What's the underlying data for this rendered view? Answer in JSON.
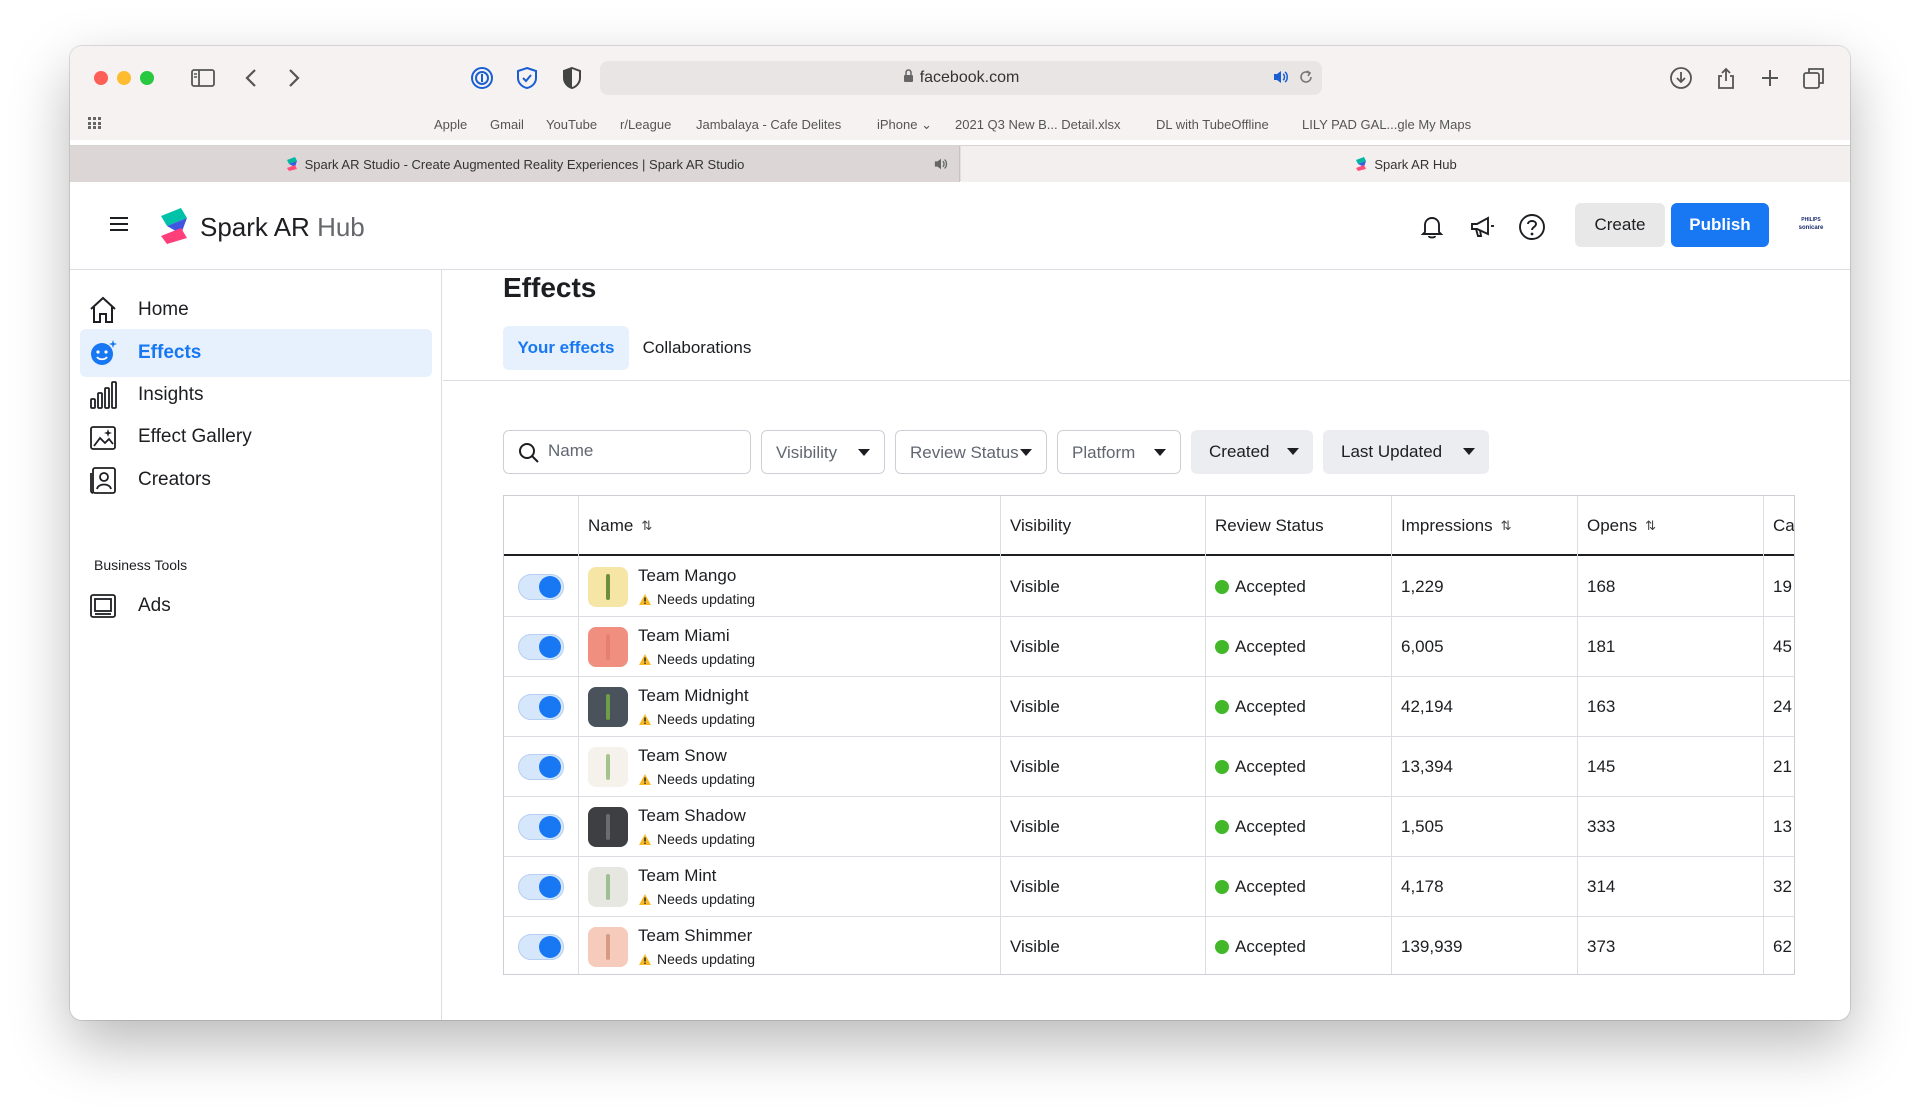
{
  "browser": {
    "url": "facebook.com",
    "bookmarks": [
      "Apple",
      "Gmail",
      "YouTube",
      "r/League",
      "Jambalaya - Cafe Delites",
      "iPhone",
      "2021 Q3 New B... Detail.xlsx",
      "DL with TubeOffline",
      "LILY PAD GAL...gle My Maps"
    ],
    "tabs": [
      {
        "label": "Spark AR Studio - Create Augmented Reality Experiences | Spark AR Studio",
        "active": false
      },
      {
        "label": "Spark AR Hub",
        "active": true
      }
    ]
  },
  "header": {
    "brand_main": "Spark AR",
    "brand_sub": "Hub",
    "create_label": "Create",
    "publish_label": "Publish",
    "badge_line1": "PHILIPS",
    "badge_line2": "sonicare",
    "accent": "#1877f2"
  },
  "sidebar": {
    "items": [
      {
        "label": "Home",
        "icon": "home-icon"
      },
      {
        "label": "Effects",
        "icon": "effects-icon",
        "active": true
      },
      {
        "label": "Insights",
        "icon": "insights-icon"
      },
      {
        "label": "Effect Gallery",
        "icon": "gallery-icon"
      },
      {
        "label": "Creators",
        "icon": "creators-icon"
      }
    ],
    "section_label": "Business Tools",
    "business_items": [
      {
        "label": "Ads",
        "icon": "ads-icon"
      }
    ]
  },
  "main": {
    "title": "Effects",
    "tabs": [
      {
        "label": "Your effects",
        "active": true
      },
      {
        "label": "Collaborations",
        "active": false
      }
    ],
    "search_placeholder": "Name",
    "filters": [
      "Visibility",
      "Review Status",
      "Platform",
      "Created",
      "Last Updated"
    ]
  },
  "table": {
    "columns": [
      "Name",
      "Visibility",
      "Review Status",
      "Impressions",
      "Opens",
      "Ca"
    ],
    "rows": [
      {
        "name": "Team Mango",
        "status_note": "Needs updating",
        "visibility": "Visible",
        "review": "Accepted",
        "impressions": "1,229",
        "opens": "168",
        "cap": "19",
        "thumb_bg": "#f6e6a6",
        "stick": "#6e8f3a",
        "enabled": true
      },
      {
        "name": "Team Miami",
        "status_note": "Needs updating",
        "visibility": "Visible",
        "review": "Accepted",
        "impressions": "6,005",
        "opens": "181",
        "cap": "45",
        "thumb_bg": "#f08e80",
        "stick": "#e77f6e",
        "enabled": true
      },
      {
        "name": "Team Midnight",
        "status_note": "Needs updating",
        "visibility": "Visible",
        "review": "Accepted",
        "impressions": "42,194",
        "opens": "163",
        "cap": "24",
        "thumb_bg": "#4a525c",
        "stick": "#6f9d4a",
        "enabled": true
      },
      {
        "name": "Team Snow",
        "status_note": "Needs updating",
        "visibility": "Visible",
        "review": "Accepted",
        "impressions": "13,394",
        "opens": "145",
        "cap": "21",
        "thumb_bg": "#f4f2ea",
        "stick": "#a8c28e",
        "enabled": true
      },
      {
        "name": "Team Shadow",
        "status_note": "Needs updating",
        "visibility": "Visible",
        "review": "Accepted",
        "impressions": "1,505",
        "opens": "333",
        "cap": "13",
        "thumb_bg": "#3e3f42",
        "stick": "#6a6c6f",
        "enabled": true
      },
      {
        "name": "Team Mint",
        "status_note": "Needs updating",
        "visibility": "Visible",
        "review": "Accepted",
        "impressions": "4,178",
        "opens": "314",
        "cap": "32",
        "thumb_bg": "#e7e7e2",
        "stick": "#9fbf93",
        "enabled": true
      },
      {
        "name": "Team Shimmer",
        "status_note": "Needs updating",
        "visibility": "Visible",
        "review": "Accepted",
        "impressions": "139,939",
        "opens": "373",
        "cap": "62",
        "thumb_bg": "#f6cbbb",
        "stick": "#d79a82",
        "enabled": true
      }
    ]
  }
}
